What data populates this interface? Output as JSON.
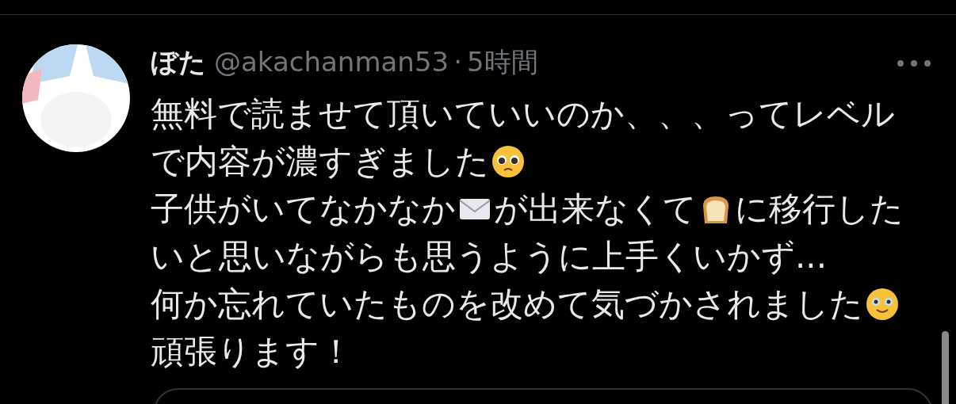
{
  "tweet": {
    "author": {
      "name": "ぼた",
      "handle": "@akachanman53",
      "separator": "·",
      "time": "5時間"
    },
    "lines": [
      {
        "segments": [
          {
            "kind": "text",
            "text": "無料で読ませて頂いていいのか、、、ってレベル"
          }
        ]
      },
      {
        "segments": [
          {
            "kind": "text",
            "text": "で内容が濃すぎました"
          },
          {
            "kind": "pleading"
          }
        ]
      },
      {
        "segments": [
          {
            "kind": "text",
            "text": "子供がいてなかなか"
          },
          {
            "kind": "envelope"
          },
          {
            "kind": "text",
            "text": "が出来なくて"
          },
          {
            "kind": "bread"
          },
          {
            "kind": "text",
            "text": "に移行した"
          }
        ]
      },
      {
        "segments": [
          {
            "kind": "text",
            "text": "いと思いながらも思うように上手くいかず..."
          }
        ]
      },
      {
        "segments": [
          {
            "kind": "text",
            "text": "何か忘れていたものを改めて気づかされました"
          },
          {
            "kind": "teary"
          }
        ]
      },
      {
        "segments": [
          {
            "kind": "text",
            "text": "頑張ります！"
          }
        ]
      }
    ]
  }
}
